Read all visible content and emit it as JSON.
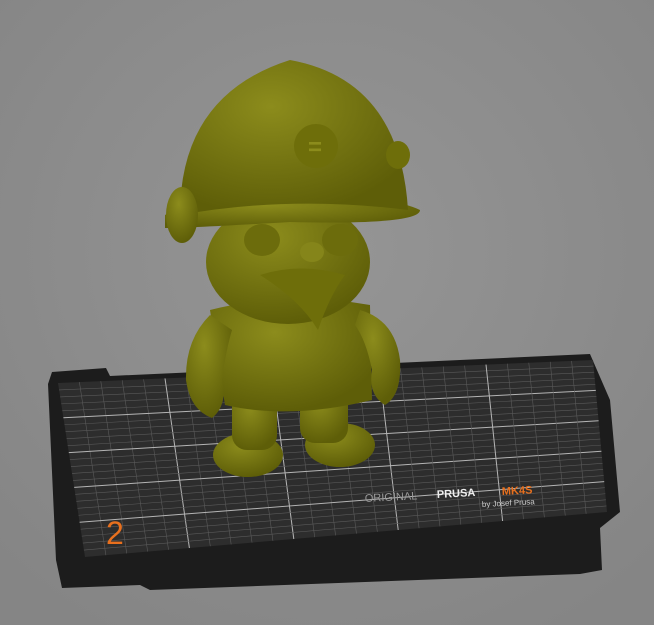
{
  "viewport": {
    "bed_label": {
      "brand_prefix": "ORIGINAL",
      "brand": "PRUSA",
      "model": "MK4S",
      "byline": "by Josef Prusa"
    },
    "plate_number": "2"
  },
  "colors": {
    "background": "#8c8c8c",
    "bed": "#2b2b2b",
    "grid": "#7a7a7a",
    "model": "#77770f",
    "accent": "#e8701e"
  }
}
